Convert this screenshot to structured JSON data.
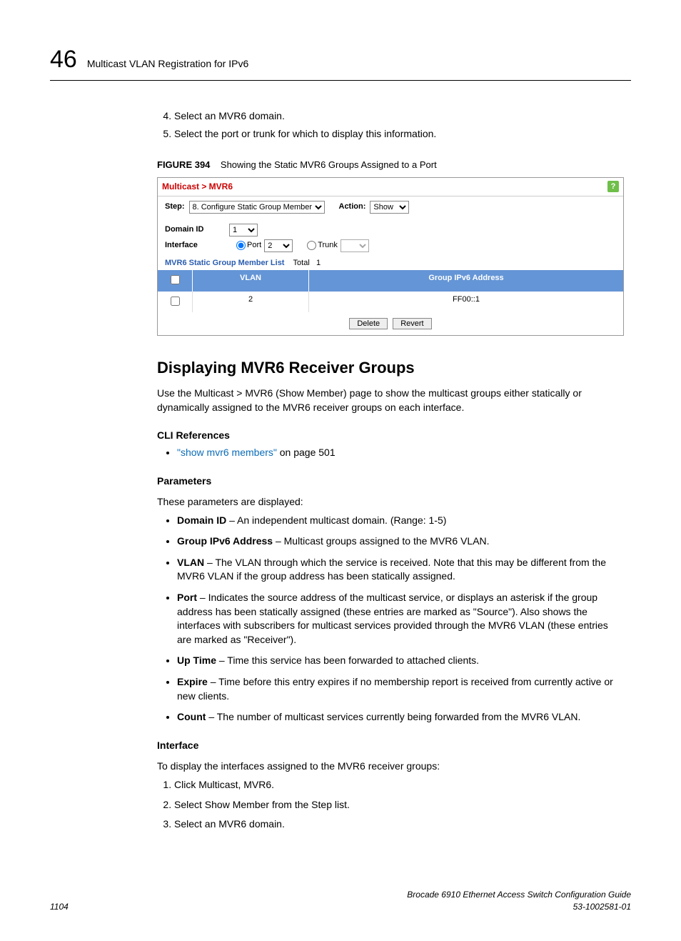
{
  "header": {
    "chapter_number": "46",
    "chapter_title": "Multicast VLAN Registration for IPv6"
  },
  "top_steps": [
    "Select an MVR6 domain.",
    "Select the port or trunk for which to display this information."
  ],
  "figure": {
    "label": "FIGURE 394",
    "caption": "Showing the Static MVR6 Groups Assigned to a Port"
  },
  "ui": {
    "breadcrumb": "Multicast > MVR6",
    "step_label": "Step:",
    "step_value": "8. Configure Static Group Member",
    "action_label": "Action:",
    "action_value": "Show",
    "domain_label": "Domain ID",
    "domain_value": "1",
    "interface_label": "Interface",
    "port_label": "Port",
    "port_value": "2",
    "trunk_label": "Trunk",
    "list_title_prefix": "MVR6 Static Group Member List",
    "list_total_label": "Total",
    "list_total_value": "1",
    "columns": {
      "vlan": "VLAN",
      "addr": "Group IPv6 Address"
    },
    "rows": [
      {
        "vlan": "2",
        "addr": "FF00::1"
      }
    ],
    "buttons": {
      "delete": "Delete",
      "revert": "Revert"
    }
  },
  "section": {
    "title": "Displaying MVR6 Receiver Groups",
    "intro": "Use the Multicast > MVR6 (Show Member) page to show the multicast groups either statically or dynamically assigned to the MVR6 receiver groups on each interface.",
    "cli_ref_heading": "CLI References",
    "cli_link_text": "\"show mvr6 members\"",
    "cli_link_suffix": " on page 501",
    "params_heading": "Parameters",
    "params_intro": "These parameters are displayed:",
    "params": [
      {
        "term": "Domain ID",
        "desc": " – An independent multicast domain. (Range: 1-5)"
      },
      {
        "term": "Group IPv6 Address",
        "desc": " – Multicast groups assigned to the MVR6 VLAN."
      },
      {
        "term": "VLAN",
        "desc": " – The VLAN through which the service is received. Note that this may be different from the MVR6 VLAN if the group address has been statically assigned."
      },
      {
        "term": "Port",
        "desc": " – Indicates the source address of the multicast service, or displays an asterisk if the group address has been statically assigned (these entries are marked as \"Source\"). Also shows the interfaces with subscribers for multicast services provided through the MVR6 VLAN (these entries are marked as \"Receiver\")."
      },
      {
        "term": "Up Time",
        "desc": " – Time this service has been forwarded to attached clients."
      },
      {
        "term": "Expire",
        "desc": " – Time before this entry expires if no membership report is received from currently active or new clients."
      },
      {
        "term": "Count",
        "desc": " – The number of multicast services currently being forwarded from the MVR6 VLAN."
      }
    ],
    "iface_heading": "Interface",
    "iface_intro": "To display the interfaces assigned to the MVR6 receiver groups:",
    "iface_steps": [
      "Click Multicast, MVR6.",
      "Select Show Member from the Step list.",
      "Select an MVR6 domain."
    ]
  },
  "footer": {
    "page": "1104",
    "doc_title": "Brocade 6910 Ethernet Access Switch Configuration Guide",
    "doc_id": "53-1002581-01"
  }
}
